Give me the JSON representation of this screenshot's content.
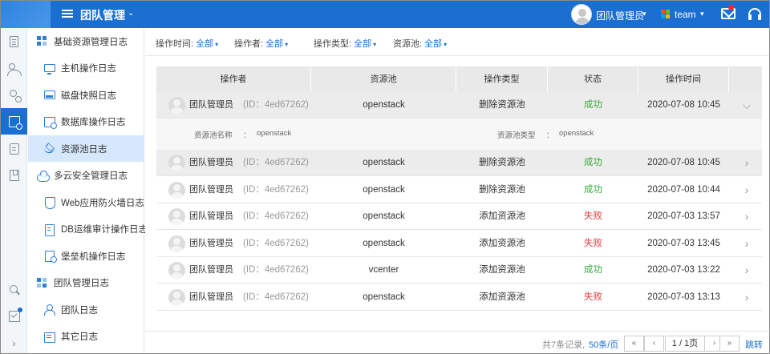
{
  "header": {
    "title": "团队管理",
    "user_name": "团队管理员",
    "team_name": "team"
  },
  "sidebar": {
    "items": [
      {
        "label": "基础资源管理日志",
        "type": "group",
        "icon": "grid-icon"
      },
      {
        "label": "主机操作日志",
        "type": "child",
        "icon": "monitor-icon"
      },
      {
        "label": "磁盘快照日志",
        "type": "child",
        "icon": "disk-icon"
      },
      {
        "label": "数据库操作日志",
        "type": "child",
        "icon": "database-log-icon"
      },
      {
        "label": "资源池日志",
        "type": "child",
        "icon": "layers-icon",
        "active": true
      },
      {
        "label": "多云安全管理日志",
        "type": "group",
        "icon": "cloud-icon"
      },
      {
        "label": "Web应用防火墙日志",
        "type": "child",
        "icon": "shield-icon"
      },
      {
        "label": "DB运维审计操作日志",
        "type": "child",
        "icon": "file-icon"
      },
      {
        "label": "堡垒机操作日志",
        "type": "child",
        "icon": "bastion-icon"
      },
      {
        "label": "团队管理日志",
        "type": "group",
        "icon": "team-grid-icon"
      },
      {
        "label": "团队日志",
        "type": "child",
        "icon": "person-icon"
      },
      {
        "label": "其它日志",
        "type": "child",
        "icon": "other-log-icon"
      }
    ]
  },
  "filters": {
    "time_label": "操作时间:",
    "time_value": "全部",
    "operator_label": "操作者:",
    "operator_value": "全部",
    "optype_label": "操作类型:",
    "optype_value": "全部",
    "pool_label": "资源池:",
    "pool_value": "全部"
  },
  "table": {
    "headers": [
      "操作者",
      "资源池",
      "操作类型",
      "状态",
      "操作时间"
    ],
    "rows": [
      {
        "name": "团队管理员",
        "id": "(ID：4ed67262)",
        "pool": "openstack",
        "op": "删除资源池",
        "status": "成功",
        "status_kind": "ok",
        "time": "2020-07-08 10:45",
        "chevron": "⌵"
      },
      {
        "name": "团队管理员",
        "id": "(ID：4ed67262)",
        "pool": "openstack",
        "op": "删除资源池",
        "status": "成功",
        "status_kind": "ok",
        "time": "2020-07-08 10:45",
        "chevron": "›"
      },
      {
        "name": "团队管理员",
        "id": "(ID：4ed67262)",
        "pool": "openstack",
        "op": "删除资源池",
        "status": "成功",
        "status_kind": "ok",
        "time": "2020-07-08 10:44",
        "chevron": "›"
      },
      {
        "name": "团队管理员",
        "id": "(ID：4ed67262)",
        "pool": "openstack",
        "op": "添加资源池",
        "status": "失败",
        "status_kind": "fail",
        "time": "2020-07-03 13:57",
        "chevron": "›"
      },
      {
        "name": "团队管理员",
        "id": "(ID：4ed67262)",
        "pool": "openstack",
        "op": "添加资源池",
        "status": "失败",
        "status_kind": "fail",
        "time": "2020-07-03 13:45",
        "chevron": "›"
      },
      {
        "name": "团队管理员",
        "id": "(ID：4ed67262)",
        "pool": "vcenter",
        "op": "添加资源池",
        "status": "成功",
        "status_kind": "ok",
        "time": "2020-07-03 13:22",
        "chevron": "›"
      },
      {
        "name": "团队管理员",
        "id": "(ID：4ed67262)",
        "pool": "openstack",
        "op": "添加资源池",
        "status": "失败",
        "status_kind": "fail",
        "time": "2020-07-03 13:13",
        "chevron": "›"
      }
    ],
    "detail": {
      "name_label": "资源池名称",
      "name_sep": "：",
      "name_value": "openstack",
      "type_label": "资源池类型",
      "type_sep": "：",
      "type_value": "openstack"
    }
  },
  "pagination": {
    "total": "共7条记录,",
    "page_size": "50条/页",
    "first": "«",
    "prev": "‹",
    "next": "›",
    "last": "»",
    "page_info": "1 / 1页",
    "jump": "跳转"
  },
  "colors": {
    "brand": "#1a6fd1",
    "success": "#3aa83a",
    "fail": "#e23b3b"
  }
}
